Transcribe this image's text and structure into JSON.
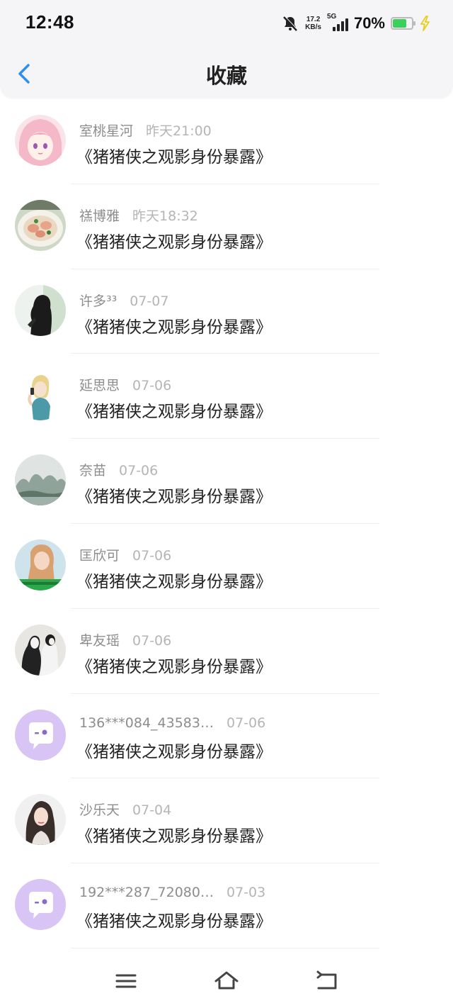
{
  "status_bar": {
    "time": "12:48",
    "net_speed_value": "17.2",
    "net_speed_unit": "KB/s",
    "network_type": "5G",
    "battery_percent": "70%",
    "battery_level": 0.7
  },
  "header": {
    "title": "收藏",
    "back_icon": "chevron-left-icon"
  },
  "items": [
    {
      "name": "室桃星河",
      "time": "昨天21:00",
      "content": "《猪猪侠之观影身份暴露》",
      "avatar": "anime-girl"
    },
    {
      "name": "禚博雅",
      "time": "昨天18:32",
      "content": "《猪猪侠之观影身份暴露》",
      "avatar": "food"
    },
    {
      "name": "许多³³",
      "time": "07-07",
      "content": "《猪猪侠之观影身份暴露》",
      "avatar": "silhouette"
    },
    {
      "name": "延思思",
      "time": "07-06",
      "content": "《猪猪侠之观影身份暴露》",
      "avatar": "cartoon-phone"
    },
    {
      "name": "奈苗",
      "time": "07-06",
      "content": "《猪猪侠之观影身份暴露》",
      "avatar": "landscape"
    },
    {
      "name": "匡欣可",
      "time": "07-06",
      "content": "《猪猪侠之观影身份暴露》",
      "avatar": "woman-photo"
    },
    {
      "name": "卑友瑶",
      "time": "07-06",
      "content": "《猪猪侠之观影身份暴露》",
      "avatar": "couple"
    },
    {
      "name": "136***084_43583…",
      "time": "07-06",
      "content": "《猪猪侠之观影身份暴露》",
      "avatar": "default-chat"
    },
    {
      "name": "沙乐天",
      "time": "07-04",
      "content": "《猪猪侠之观影身份暴露》",
      "avatar": "portrait"
    },
    {
      "name": "192***287_72080…",
      "time": "07-03",
      "content": "《猪猪侠之观影身份暴露》",
      "avatar": "default-chat"
    }
  ],
  "nav": {
    "menu_icon": "menu-icon",
    "home_icon": "home-icon",
    "back_icon": "back-icon"
  },
  "colors": {
    "accent": "#2f8ef0",
    "default_avatar": "#d8c4f5",
    "battery": "#3ad15a"
  }
}
